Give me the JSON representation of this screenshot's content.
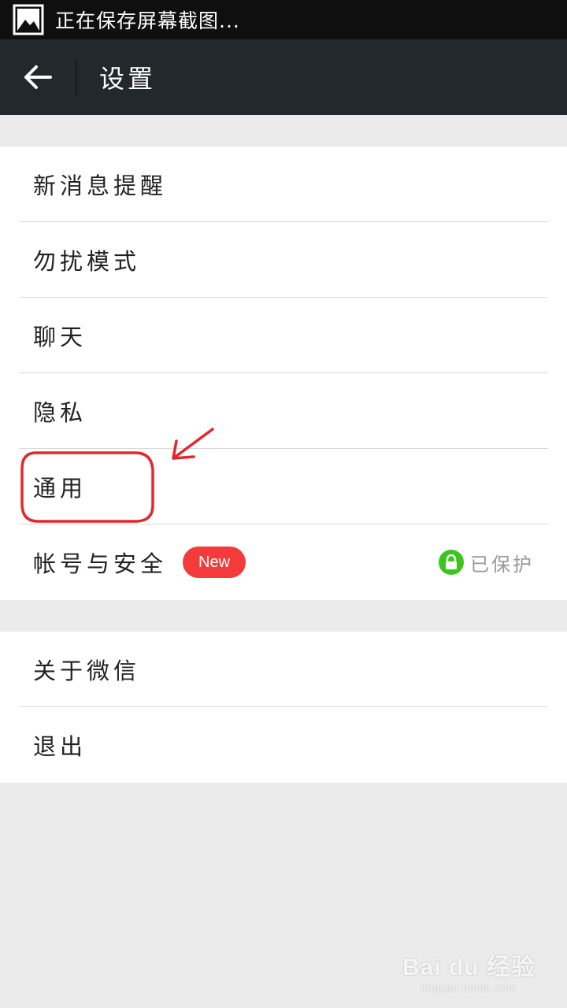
{
  "status_bar": {
    "icon": "image-icon",
    "text": "正在保存屏幕截图..."
  },
  "action_bar": {
    "back_icon": "arrow-left-icon",
    "title": "设置"
  },
  "group1": {
    "items": [
      {
        "label": "新消息提醒"
      },
      {
        "label": "勿扰模式"
      },
      {
        "label": "聊天"
      },
      {
        "label": "隐私"
      },
      {
        "label": "通用"
      },
      {
        "label": "帐号与安全",
        "badge": "New",
        "status": "已保护",
        "status_icon": "lock-icon"
      }
    ]
  },
  "group2": {
    "items": [
      {
        "label": "关于微信"
      },
      {
        "label": "退出"
      }
    ]
  },
  "watermark": {
    "logo": "Bai du 经验",
    "sub": "jingyan.baidu.com"
  },
  "colors": {
    "status_bar_bg": "#0f0f0f",
    "action_bar_bg": "#22292c",
    "page_bg": "#ebebeb",
    "badge_bg": "#f43b3b",
    "lock_green": "#3cc51f",
    "annotation_red": "#e0282e"
  }
}
